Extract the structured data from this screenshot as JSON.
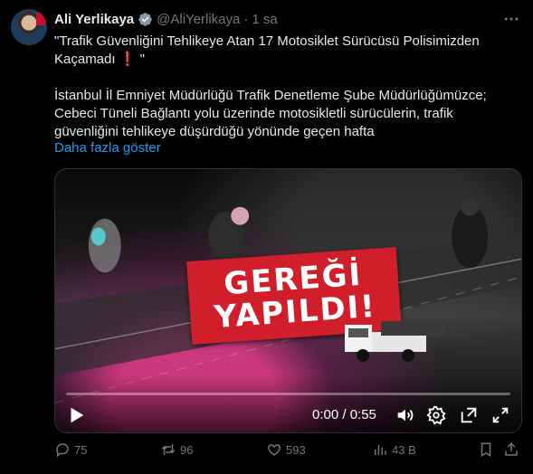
{
  "author": {
    "name": "Ali Yerlikaya",
    "handle": "@AliYerlikaya",
    "separator": "·",
    "time": "1 sa"
  },
  "tweet": {
    "line1": "\"Trafik Güvenliğini Tehlikeye Atan 17 Motosiklet Sürücüsü Polisimizden",
    "line2_text": "Kaçamadı ",
    "line2_emoji": "❗",
    "line2_end": " \"",
    "line3": "İstanbul İl Emniyet Müdürlüğü Trafik Denetleme Şube Müdürlüğümüzce;",
    "line4": "Cebeci Tüneli Bağlantı yolu üzerinde motosikletli sürücülerin, trafik",
    "line5": "güvenliğini tehlikeye düşürdüğü yönünde geçen hafta",
    "show_more": "Daha fazla göster"
  },
  "video": {
    "banner_line1": "GEREĞİ",
    "banner_line2": "YAPILDI!",
    "timecode": "0:00 / 0:55",
    "progress": 0
  },
  "actions": {
    "replies": "75",
    "reposts": "96",
    "likes": "593",
    "views": "43 B"
  },
  "colors": {
    "accent": "#1d9bf0",
    "muted": "#71767b",
    "banner": "#d01f2b"
  }
}
